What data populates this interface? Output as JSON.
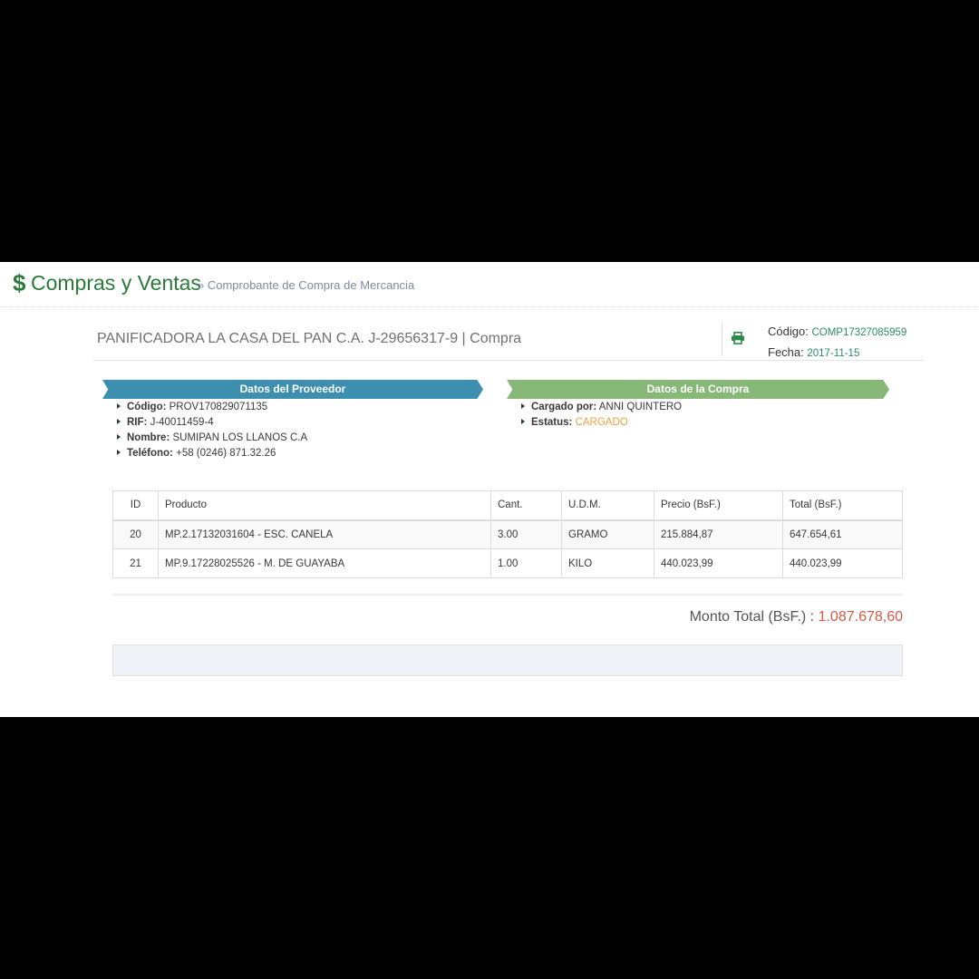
{
  "header": {
    "title": "Compras y Ventas",
    "subtitle": "» Comprobante de Compra de Mercancia",
    "icon": "dollar-icon"
  },
  "invoice": {
    "title": "PANIFICADORA LA CASA DEL PAN C.A. J-29656317-9 | Compra",
    "code_label": "Código:",
    "code_value": "COMP17327085959",
    "date_label": "Fecha:",
    "date_value": "2017-11-15",
    "print_icon": "print-icon"
  },
  "supplier": {
    "heading": "Datos del Proveedor",
    "items": [
      {
        "label": "Código:",
        "value": "PROV170829071135"
      },
      {
        "label": "RIF:",
        "value": "J-40011459-4"
      },
      {
        "label": "Nombre:",
        "value": "SUMIPAN LOS LLANOS C.A"
      },
      {
        "label": "Teléfono:",
        "value": "+58 (0246) 871.32.26"
      }
    ]
  },
  "purchase": {
    "heading": "Datos de la Compra",
    "items": [
      {
        "label": "Cargado por:",
        "value": "ANNI QUINTERO"
      },
      {
        "label": "Estatus:",
        "value": "CARGADO"
      }
    ]
  },
  "table": {
    "headers": [
      "ID",
      "Producto",
      "Cant.",
      "U.D.M.",
      "Precio (BsF.)",
      "Total (BsF.)"
    ],
    "rows": [
      [
        "20",
        "MP.2.17132031604 - ESC. CANELA",
        "3.00",
        "GRAMO",
        "215.884,87",
        "647.654,61"
      ],
      [
        "21",
        "MP.9.17228025526 - M. DE GUAYABA",
        "1.00",
        "KILO",
        "440.023,99",
        "440.023,99"
      ]
    ]
  },
  "summary": {
    "label": "Monto Total (BsF.) :",
    "amount": "1.087.678,60"
  },
  "colors": {
    "brand_green": "#2b7a3a",
    "ribbon_blue": "#3d8fb0",
    "ribbon_green": "#87b878",
    "status_orange": "#f0a040",
    "amount_red": "#d15b47"
  }
}
